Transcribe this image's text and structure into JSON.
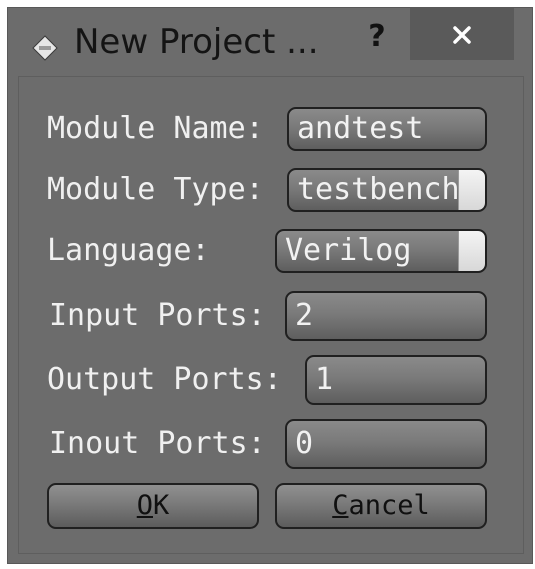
{
  "window": {
    "title": "New Project ...",
    "help_label": "?"
  },
  "form": {
    "module_name": {
      "label": "Module Name:",
      "value": "andtest"
    },
    "module_type": {
      "label": "Module Type:",
      "value": "testbench"
    },
    "language": {
      "label": "Language:",
      "value": "Verilog"
    },
    "input_ports": {
      "label": "Input Ports:",
      "value": "2"
    },
    "output_ports": {
      "label": "Output Ports:",
      "value": "1"
    },
    "inout_ports": {
      "label": "Inout Ports:",
      "value": "0"
    }
  },
  "buttons": {
    "ok": {
      "mnemonic": "O",
      "rest": "K"
    },
    "cancel": {
      "mnemonic": "C",
      "rest": "ancel"
    }
  }
}
